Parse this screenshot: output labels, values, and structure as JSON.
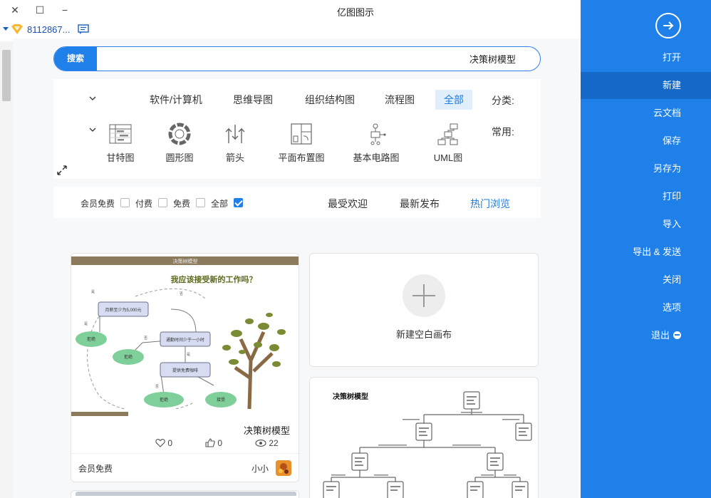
{
  "window": {
    "title": "亿图图示",
    "close_glyph": "✕",
    "maximize_glyph": "☐",
    "minimize_glyph": "−"
  },
  "account": {
    "user_id": "8112867...",
    "vip_icon": "vip-diamond-icon",
    "message_icon": "message-icon"
  },
  "search": {
    "button_label": "搜索",
    "value": "决策树模型"
  },
  "sidebar": {
    "open_icon": "arrow-right-circle-icon",
    "items": [
      {
        "label": "打开",
        "active": false
      },
      {
        "label": "新建",
        "active": true
      },
      {
        "label": "云文档",
        "active": false
      },
      {
        "label": "保存",
        "active": false
      },
      {
        "label": "另存为",
        "active": false
      },
      {
        "label": "打印",
        "active": false
      },
      {
        "label": "导入",
        "active": false
      },
      {
        "label": "导出 & 发送",
        "active": false
      },
      {
        "label": "关闭",
        "active": false
      },
      {
        "label": "选项",
        "active": false
      },
      {
        "label": "退出",
        "active": false
      }
    ]
  },
  "categories": {
    "label": "分类:",
    "tabs": [
      "全部",
      "流程图",
      "组织结构图",
      "思维导图",
      "软件/计算机"
    ],
    "active_tab": "全部"
  },
  "common": {
    "label": "常用:",
    "items": [
      {
        "label": "UML图",
        "icon": "uml-icon"
      },
      {
        "label": "基本电路图",
        "icon": "circuit-icon"
      },
      {
        "label": "平面布置图",
        "icon": "floorplan-icon"
      },
      {
        "label": "箭头",
        "icon": "arrows-icon"
      },
      {
        "label": "圆形图",
        "icon": "circle-diagram-icon"
      },
      {
        "label": "甘特图",
        "icon": "gantt-icon"
      }
    ]
  },
  "sort": {
    "tabs": [
      "热门浏览",
      "最新发布",
      "最受欢迎"
    ],
    "active_tab": "热门浏览"
  },
  "filters": [
    {
      "label": "全部",
      "checked": true
    },
    {
      "label": "免费",
      "checked": false
    },
    {
      "label": "付费",
      "checked": false
    },
    {
      "label": "会员免费",
      "checked": false
    }
  ],
  "blank_card": {
    "label": "新建空白画布"
  },
  "template_card": {
    "preview_header": "决策树模型",
    "preview_question": "我应该接受新的工作吗？",
    "preview_nodes": [
      "月薪至少为5,000元",
      "通勤时间少于一小时",
      "提供免费咖啡",
      "拒绝",
      "拒绝",
      "拒绝",
      "接受"
    ],
    "preview_edge_labels": [
      "是",
      "否",
      "是",
      "否",
      "是",
      "否"
    ],
    "title": "决策树模型",
    "views": "22",
    "likes": "0",
    "favorites": "0",
    "author": "小小",
    "price": "会员免费"
  },
  "tree_card": {
    "title": "决策树模型"
  },
  "colors": {
    "accent": "#1e80e8",
    "sidebar_active": "#1469c8",
    "tree_band": "#8b7a5c",
    "decision_node": "#d7dcf2",
    "leaf_node": "#7fcf9a"
  }
}
